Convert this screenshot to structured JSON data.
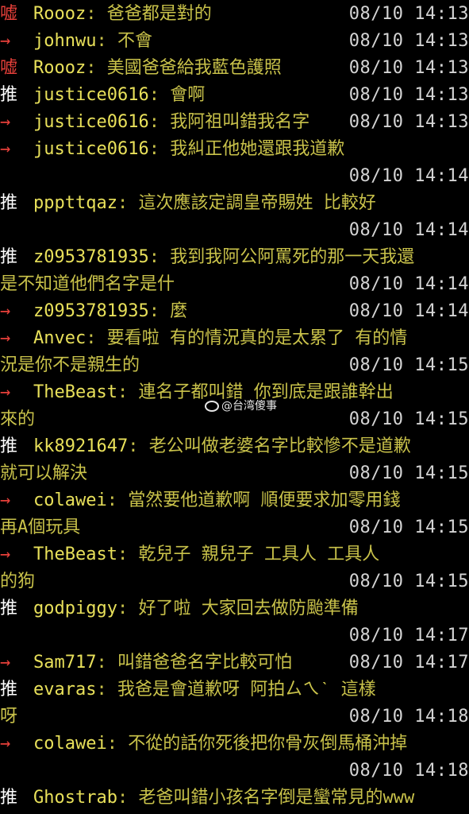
{
  "comments": [
    {
      "type": "嘘",
      "user": "Roooz",
      "content": ": 爸爸都是對的",
      "time": "08/10 14:13"
    },
    {
      "type": "→",
      "user": "johnwu",
      "content": ": 不會",
      "time": "08/10 14:13"
    },
    {
      "type": "嘘",
      "user": "Roooz",
      "content": ": 美國爸爸給我藍色護照",
      "time": "08/10 14:13"
    },
    {
      "type": "推",
      "user": "justice0616",
      "content": ": 會啊",
      "time": "08/10 14:13"
    },
    {
      "type": "→",
      "user": "justice0616",
      "content": ": 我阿祖叫錯我名字",
      "time": "08/10 14:13"
    },
    {
      "type": "→",
      "user": "justice0616",
      "content": ": 我糾正他她還跟我道歉",
      "time": "08/10 14:14"
    },
    {
      "type": "推",
      "user": "pppttqaz",
      "content": ": 這次應該定調皇帝賜姓 比較好",
      "time": "08/10 14:14"
    },
    {
      "type": "推",
      "user": "z0953781935",
      "content": ": 我到我阿公阿罵死的那一天我還",
      "continuation": "是不知道他們名字是什",
      "time": "08/10 14:14"
    },
    {
      "type": "→",
      "user": "z0953781935",
      "content": ": 麼",
      "time": "08/10 14:14"
    },
    {
      "type": "→",
      "user": "Anvec",
      "content": ": 要看啦 有的情況真的是太累了 有的情",
      "continuation": "況是你不是親生的",
      "time": "08/10 14:15"
    },
    {
      "type": "→",
      "user": "TheBeast",
      "content": ": 連名子都叫錯  你到底是跟誰幹出",
      "continuation": "來的",
      "time": "08/10 14:15"
    },
    {
      "type": "推",
      "user": "kk8921647",
      "content": ": 老公叫做老婆名字比較慘不是道歉",
      "continuation": "就可以解決",
      "time": "08/10 14:15"
    },
    {
      "type": "→",
      "user": "colawei",
      "content": ": 當然要他道歉啊 順便要求加零用錢",
      "continuation": "再A個玩具",
      "time": "08/10 14:15"
    },
    {
      "type": "→",
      "user": "TheBeast",
      "content": ": 乾兒子  親兒子  工具人   工具人",
      "continuation": "的狗",
      "time": "08/10 14:15"
    },
    {
      "type": "推",
      "user": "godpiggy",
      "content": ": 好了啦 大家回去做防颱準備",
      "time": "08/10 14:17"
    },
    {
      "type": "→",
      "user": "Sam717",
      "content": ": 叫錯爸爸名字比較可怕",
      "time": "08/10 14:17"
    },
    {
      "type": "推",
      "user": "evaras",
      "content": ": 我爸是會道歉呀  阿拍ㄙㄟˋ  這樣",
      "continuation": "呀",
      "time": "08/10 14:18"
    },
    {
      "type": "→",
      "user": "colawei",
      "content": ": 不從的話你死後把你骨灰倒馬桶沖掉",
      "time": "08/10 14:18"
    },
    {
      "type": "推",
      "user": "Ghostrab",
      "content": ": 老爸叫錯小孩名字倒是蠻常見的www",
      "time": ""
    }
  ],
  "watermark": "@台湾傻事"
}
